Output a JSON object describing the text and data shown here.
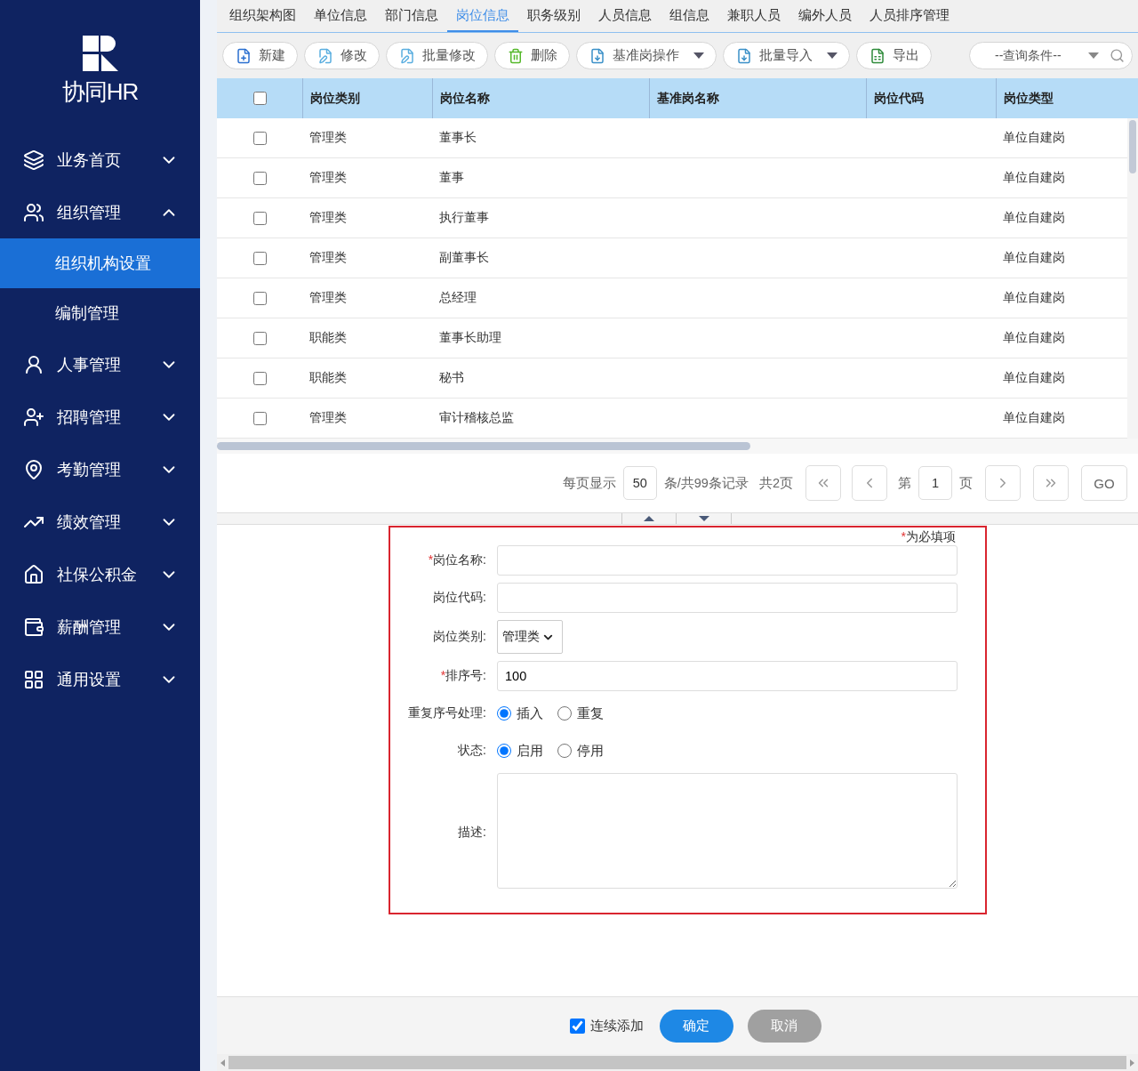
{
  "logo": {
    "text": "协同HR"
  },
  "sidebar": {
    "items": [
      {
        "label": "业务首页",
        "kind": "layers",
        "expanded": false
      },
      {
        "label": "组织管理",
        "kind": "org",
        "expanded": true,
        "children": [
          {
            "label": "组织机构设置",
            "selected": true
          },
          {
            "label": "编制管理",
            "selected": false
          }
        ]
      },
      {
        "label": "人事管理",
        "kind": "person",
        "expanded": false
      },
      {
        "label": "招聘管理",
        "kind": "recruit",
        "expanded": false
      },
      {
        "label": "考勤管理",
        "kind": "attendance",
        "expanded": false
      },
      {
        "label": "绩效管理",
        "kind": "performance",
        "expanded": false
      },
      {
        "label": "社保公积金",
        "kind": "insurance",
        "expanded": false
      },
      {
        "label": "薪酬管理",
        "kind": "salary",
        "expanded": false
      },
      {
        "label": "通用设置",
        "kind": "settings",
        "expanded": false
      }
    ]
  },
  "tabs": [
    {
      "label": "组织架构图",
      "selected": false
    },
    {
      "label": "单位信息",
      "selected": false
    },
    {
      "label": "部门信息",
      "selected": false
    },
    {
      "label": "岗位信息",
      "selected": true
    },
    {
      "label": "职务级别",
      "selected": false
    },
    {
      "label": "人员信息",
      "selected": false
    },
    {
      "label": "组信息",
      "selected": false
    },
    {
      "label": "兼职人员",
      "selected": false
    },
    {
      "label": "编外人员",
      "selected": false
    },
    {
      "label": "人员排序管理",
      "selected": false
    }
  ],
  "toolbar": {
    "buttons": [
      {
        "label": "新建",
        "kind": "create",
        "dropdown": false
      },
      {
        "label": "修改",
        "kind": "edit",
        "dropdown": false
      },
      {
        "label": "批量修改",
        "kind": "edit",
        "dropdown": false
      },
      {
        "label": "删除",
        "kind": "delete",
        "dropdown": false
      },
      {
        "label": "基准岗操作",
        "kind": "import",
        "dropdown": true
      },
      {
        "label": "批量导入",
        "kind": "import",
        "dropdown": true
      },
      {
        "label": "导出",
        "kind": "export",
        "dropdown": false
      }
    ],
    "query": {
      "placeholder": "--查询条件--"
    }
  },
  "table": {
    "all_checked": false,
    "columns": [
      "岗位类别",
      "岗位名称",
      "基准岗名称",
      "岗位代码",
      "岗位类型"
    ],
    "rows": [
      {
        "checked": false,
        "cells": [
          "管理类",
          "董事长",
          "",
          "",
          "单位自建岗"
        ]
      },
      {
        "checked": false,
        "cells": [
          "管理类",
          "董事",
          "",
          "",
          "单位自建岗"
        ]
      },
      {
        "checked": false,
        "cells": [
          "管理类",
          "执行董事",
          "",
          "",
          "单位自建岗"
        ]
      },
      {
        "checked": false,
        "cells": [
          "管理类",
          "副董事长",
          "",
          "",
          "单位自建岗"
        ]
      },
      {
        "checked": false,
        "cells": [
          "管理类",
          "总经理",
          "",
          "",
          "单位自建岗"
        ]
      },
      {
        "checked": false,
        "cells": [
          "职能类",
          "董事长助理",
          "",
          "",
          "单位自建岗"
        ]
      },
      {
        "checked": false,
        "cells": [
          "职能类",
          "秘书",
          "",
          "",
          "单位自建岗"
        ]
      },
      {
        "checked": false,
        "cells": [
          "管理类",
          "审计稽核总监",
          "",
          "",
          "单位自建岗"
        ]
      }
    ]
  },
  "pagination": {
    "per_page_label": "每页显示",
    "per_page": "50",
    "records": "条/共99条记录",
    "pages": "共2页",
    "page_prefix": "第",
    "page": "1",
    "page_suffix": "页",
    "go": "GO"
  },
  "form": {
    "required_note": {
      "mark": "*",
      "text": "为必填项"
    },
    "fields": [
      {
        "kind": "text",
        "label": "岗位名称:",
        "required_mark": "*"
      },
      {
        "kind": "text",
        "label": "岗位代码:"
      },
      {
        "kind": "select",
        "label": "岗位类别:",
        "value": "管理类"
      },
      {
        "kind": "text",
        "label": "排序号:",
        "required_mark": "*",
        "value": "100"
      },
      {
        "kind": "radio",
        "label": "重复序号处理:",
        "options": [
          {
            "label": "插入",
            "selected": true
          },
          {
            "label": "重复",
            "selected": false
          }
        ]
      },
      {
        "kind": "radio",
        "label": "状态:",
        "options": [
          {
            "label": "启用",
            "selected": true
          },
          {
            "label": "停用",
            "selected": false
          }
        ]
      },
      {
        "kind": "textarea",
        "label": "描述:"
      }
    ]
  },
  "footer": {
    "continue": {
      "label": "连续添加",
      "checked": true
    },
    "confirm": "确定",
    "cancel": "取消"
  }
}
